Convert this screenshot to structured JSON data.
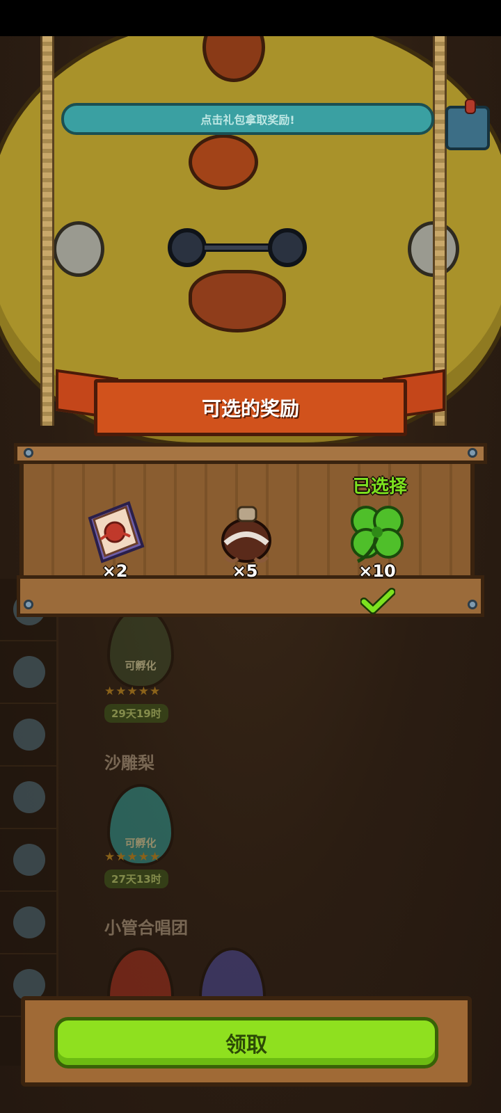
{
  "hint": {
    "text": "点击礼包拿取奖励!"
  },
  "panel": {
    "title": "可选的奖励",
    "selected_label": "已选择",
    "rewards": [
      {
        "icon": "scroll-icon",
        "qty": "×2",
        "selected": false
      },
      {
        "icon": "potion-bag-icon",
        "qty": "×5",
        "selected": false
      },
      {
        "icon": "four-leaf-clover-icon",
        "qty": "×10",
        "selected": true
      }
    ]
  },
  "background_list": {
    "egg_status": "可孵化",
    "rating": "★★★★★",
    "groups": [
      {
        "name": "",
        "timer": "29天19时"
      },
      {
        "name": "沙雕梨",
        "timer": "27天13时"
      },
      {
        "name": "小管合唱团",
        "timer": ""
      }
    ]
  },
  "claim_button": {
    "label": "领取"
  },
  "colors": {
    "accent_green": "#8fe01f",
    "ribbon_orange": "#d1521c",
    "hint_teal": "#3aa0a2"
  }
}
